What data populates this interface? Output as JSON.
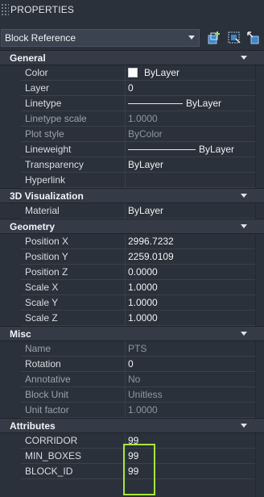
{
  "window": {
    "title": "PROPERTIES"
  },
  "toolbar": {
    "selected_object": "Block Reference",
    "icons": [
      "add-to-selection-icon",
      "quick-select-icon",
      "toggle-pickadd-icon"
    ]
  },
  "sections": {
    "general": {
      "title": "General",
      "rows": [
        {
          "label": "Color",
          "value": "ByLayer"
        },
        {
          "label": "Layer",
          "value": "0"
        },
        {
          "label": "Linetype",
          "value": "ByLayer"
        },
        {
          "label": "Linetype scale",
          "value": "1.0000"
        },
        {
          "label": "Plot style",
          "value": "ByColor"
        },
        {
          "label": "Lineweight",
          "value": "ByLayer"
        },
        {
          "label": "Transparency",
          "value": "ByLayer"
        },
        {
          "label": "Hyperlink",
          "value": ""
        }
      ]
    },
    "viz3d": {
      "title": "3D Visualization",
      "rows": [
        {
          "label": "Material",
          "value": "ByLayer"
        }
      ]
    },
    "geometry": {
      "title": "Geometry",
      "rows": [
        {
          "label": "Position X",
          "value": "2996.7232"
        },
        {
          "label": "Position Y",
          "value": "2259.0109"
        },
        {
          "label": "Position Z",
          "value": "0.0000"
        },
        {
          "label": "Scale X",
          "value": "1.0000"
        },
        {
          "label": "Scale Y",
          "value": "1.0000"
        },
        {
          "label": "Scale Z",
          "value": "1.0000"
        }
      ]
    },
    "misc": {
      "title": "Misc",
      "rows": [
        {
          "label": "Name",
          "value": "PTS"
        },
        {
          "label": "Rotation",
          "value": "0"
        },
        {
          "label": "Annotative",
          "value": "No"
        },
        {
          "label": "Block Unit",
          "value": "Unitless"
        },
        {
          "label": "Unit factor",
          "value": "1.0000"
        }
      ]
    },
    "attributes": {
      "title": "Attributes",
      "rows": [
        {
          "label": "CORRIDOR",
          "value": "99"
        },
        {
          "label": "MIN_BOXES",
          "value": "99"
        },
        {
          "label": "BLOCK_ID",
          "value": "99"
        }
      ]
    }
  },
  "colors": {
    "background": "#2b313a",
    "header": "#343b46",
    "highlight": "#a8e63a"
  }
}
